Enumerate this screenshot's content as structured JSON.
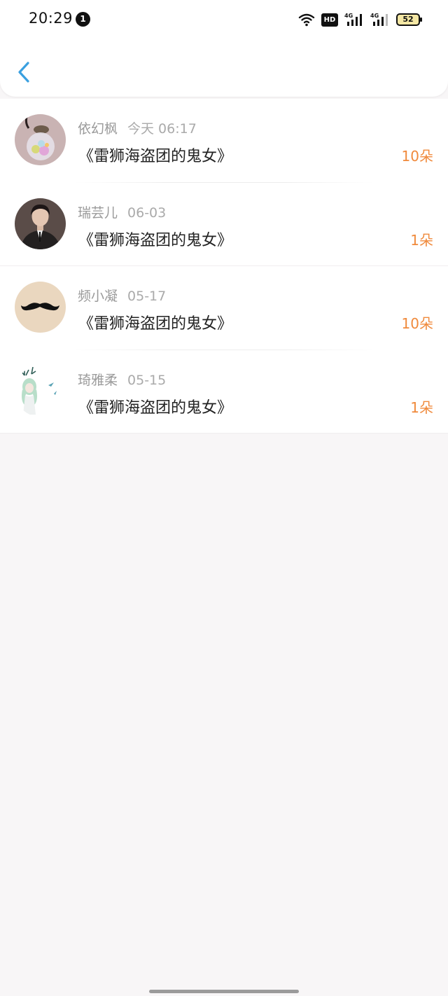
{
  "status_bar": {
    "time": "20:29",
    "notification_count": "1",
    "hd_label": "HD",
    "network_1": "4G",
    "network_2": "4G",
    "battery_level": "52"
  },
  "header": {
    "back_icon": "chevron-left-icon",
    "accent_color": "#3aa0e0"
  },
  "rows": [
    {
      "user": "依幻枫",
      "date": "今天 06:17",
      "book": "《雷狮海盗团的鬼女》",
      "gift": "10朵",
      "avatar": "glass-bottle"
    },
    {
      "user": "瑞芸儿",
      "date": "06-03",
      "book": "《雷狮海盗团的鬼女》",
      "gift": "1朵",
      "avatar": "man-in-suit"
    },
    {
      "user": "频小凝",
      "date": "05-17",
      "book": "《雷狮海盗团的鬼女》",
      "gift": "10朵",
      "avatar": "mustache"
    },
    {
      "user": "琦雅柔",
      "date": "05-15",
      "book": "《雷狮海盗团的鬼女》",
      "gift": "1朵",
      "avatar": "anime-girl"
    }
  ],
  "colors": {
    "gift": "#f08a3c",
    "username": "#9a9a9a",
    "background": "#f8f6f7"
  }
}
